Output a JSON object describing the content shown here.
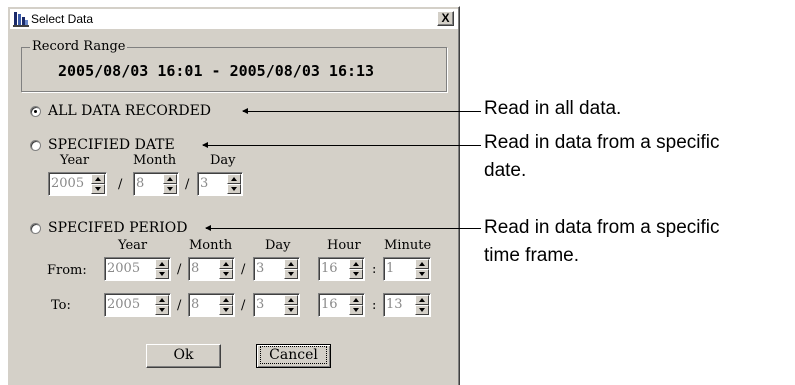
{
  "window": {
    "title": "Select Data",
    "close_glyph": "X"
  },
  "record_range": {
    "label": "Record Range",
    "value": "2005/08/03 16:01 - 2005/08/03 16:13"
  },
  "options": {
    "all": {
      "label": "ALL DATA RECORDED",
      "checked": true
    },
    "date": {
      "label": "SPECIFIED DATE",
      "checked": false
    },
    "period": {
      "label": "SPECIFED PERIOD",
      "checked": false
    }
  },
  "date_fields": {
    "year_label": "Year",
    "month_label": "Month",
    "day_label": "Day",
    "year": "2005",
    "month": "8",
    "day": "3",
    "sep": "/"
  },
  "period_fields": {
    "year_label": "Year",
    "month_label": "Month",
    "day_label": "Day",
    "hour_label": "Hour",
    "minute_label": "Minute",
    "from_label": "From:",
    "to_label": "To:",
    "date_sep": "/",
    "time_sep": ":",
    "from": {
      "year": "2005",
      "month": "8",
      "day": "3",
      "hour": "16",
      "minute": "1"
    },
    "to": {
      "year": "2005",
      "month": "8",
      "day": "3",
      "hour": "16",
      "minute": "13"
    }
  },
  "buttons": {
    "ok": "Ok",
    "cancel": "Cancel"
  },
  "annotations": {
    "all": "Read in all data.",
    "date_line1": "Read in data from a specific",
    "date_line2": "date.",
    "period_line1": "Read in data from a specific",
    "period_line2": "time frame."
  },
  "colors": {
    "dialog_bg": "#d4d0c8",
    "disabled_text": "#8a8a8a"
  }
}
